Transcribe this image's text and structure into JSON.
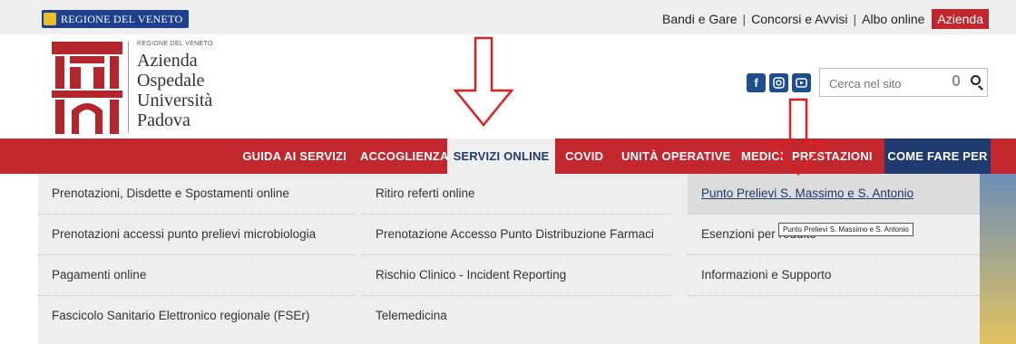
{
  "topbar": {
    "region_logo_text": "REGIONE DEL VENETO",
    "links": [
      "Bandi e Gare",
      "Concorsi e Avvisi",
      "Albo online"
    ],
    "separator": "|",
    "azienda_badge": "Azienda"
  },
  "header": {
    "logo_small": "REGIONE DEL VENETO",
    "logo_lines": [
      "Azienda",
      "Ospedale",
      "Università",
      "Padova"
    ],
    "social_icons": [
      "facebook-icon",
      "instagram-icon",
      "youtube-icon"
    ],
    "search_placeholder": "Cerca nel sito"
  },
  "nav": {
    "items": [
      {
        "label": "GUIDA AI SERVIZI"
      },
      {
        "label": "ACCOGLIENZA"
      },
      {
        "label": "SERVIZI ONLINE"
      },
      {
        "label": "COVID"
      },
      {
        "label": "UNITÀ OPERATIVE"
      },
      {
        "label": "MEDICI"
      },
      {
        "label": "PRESTAZIONI"
      },
      {
        "label": "COME FARE PER"
      }
    ],
    "active": "SERVIZI ONLINE"
  },
  "dropdown": {
    "col1": [
      "Prenotazioni, Disdette e Spostamenti online",
      "Prenotazioni accessi punto prelievi microbiologia",
      "Pagamenti online",
      "Fascicolo Sanitario Elettronico regionale (FSEr)"
    ],
    "col2": [
      "Ritiro referti online",
      "Prenotazione Accesso Punto Distribuzione Farmaci",
      "Rischio Clinico - Incident Reporting",
      "Telemedicina"
    ],
    "col3": [
      "Punto Prelievi S. Massimo e S. Antonio",
      "Esenzioni per reddito",
      "Informazioni e Supporto"
    ],
    "tooltip": "Punto Prelievi S. Massimo e S. Antonio"
  },
  "colors": {
    "brand_red": "#c1272d",
    "nav_dark_blue": "#1f3a6e",
    "annotation_arrow": "#e02020"
  }
}
